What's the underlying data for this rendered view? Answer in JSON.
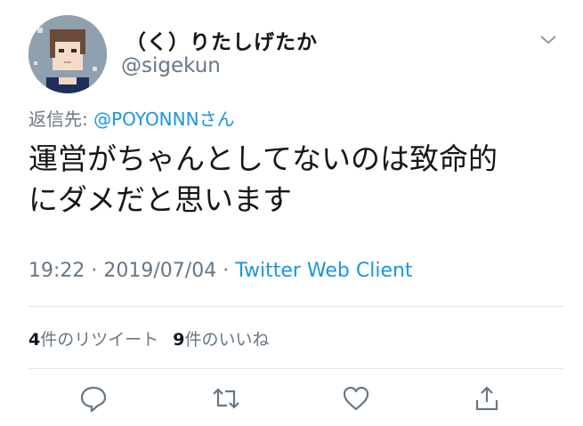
{
  "tweet": {
    "display_name": "（く）りたしげたか",
    "handle": "@sigekun",
    "reply_prefix": "返信先: ",
    "reply_mention": "@POYONNNさん",
    "text": "運営がちゃんとしてないのは致命的\nにダメだと思います",
    "time": "19:22",
    "separator": " · ",
    "date": "2019/07/04",
    "client": "Twitter Web Client"
  },
  "stats": {
    "retweets_count": "4",
    "retweets_label": "件のリツイート",
    "likes_count": "9",
    "likes_label": "件のいいね"
  },
  "actions": [
    "reply-icon",
    "retweet-icon",
    "like-icon",
    "share-icon"
  ],
  "colors": {
    "link": "#1b95e0",
    "secondary": "#657786",
    "divider": "#e1e8ed"
  }
}
